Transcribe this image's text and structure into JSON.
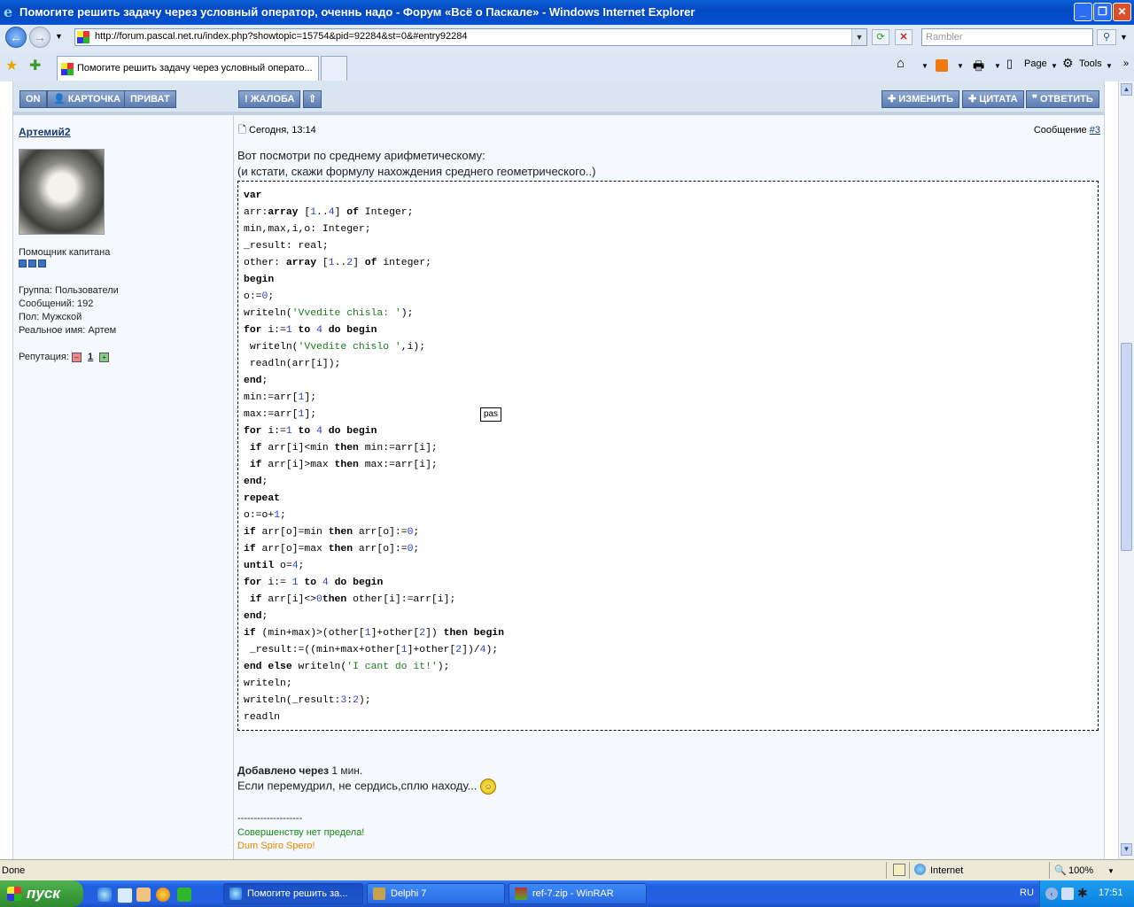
{
  "window": {
    "title": "Помогите решить задачу через условный оператор, оченнь надо - Форум «Всё о Паскале» - Windows Internet Explorer",
    "min_icon": "minimize-icon",
    "max_icon": "maximize-icon",
    "close_icon": "close-icon"
  },
  "nav": {
    "url": "http://forum.pascal.net.ru/index.php?showtopic=15754&pid=92284&st=0&#entry92284",
    "search_placeholder": "Rambler"
  },
  "tabs": {
    "active_label": "Помогите решить задачу через условный операто...",
    "page_label": "Page",
    "tools_label": "Tools"
  },
  "post": {
    "buttons_left": [
      "ON",
      "КАРТОЧКА",
      "ПРИВАТ"
    ],
    "buttons_mid": [
      "ЖАЛОБА"
    ],
    "buttons_right": [
      "ИЗМЕНИТЬ",
      "ЦИТАТА",
      "ОТВЕТИТЬ"
    ],
    "author": "Артемий2",
    "rank": "Помощник капитана",
    "group": "Группа: Пользователи",
    "messages": "Сообщений: 192",
    "gender": "Пол: Мужской",
    "realname": "Реальное имя: Артем",
    "reputation_label": "Репутация:",
    "reputation_value": "1",
    "date": "Сегодня, 13:14",
    "msg_label": "Сообщение",
    "msg_link": "#3",
    "text1": "Вот посмотри по среднему арифметическому:",
    "text2": "(и кстати, скажи формулу нахождения среднего геометрического..)",
    "code_tooltip": "pas",
    "added_label": "Добавлено через",
    "added_time": "1 мин.",
    "added_text": "Если перемудрил, не сердись,сплю находу...",
    "sig_line": "--------------------",
    "sig1": "Совершенству нет предела!",
    "sig2": "Dum Spiro Spero!"
  },
  "status": {
    "text": "Done",
    "zone": "Internet",
    "zoom": "100%"
  },
  "taskbar": {
    "start": "пуск",
    "items": [
      "Помогите решить за...",
      "Delphi 7",
      "ref-7.zip - WinRAR"
    ],
    "lang": "RU",
    "clock": "17:51"
  },
  "colors": {
    "keyword": "#000000",
    "number": "#2a3fc8",
    "string": "#1a7a1a",
    "sig1": "#1a8a1a",
    "sig2": "#e08a00",
    "link": "#1a3a73"
  }
}
